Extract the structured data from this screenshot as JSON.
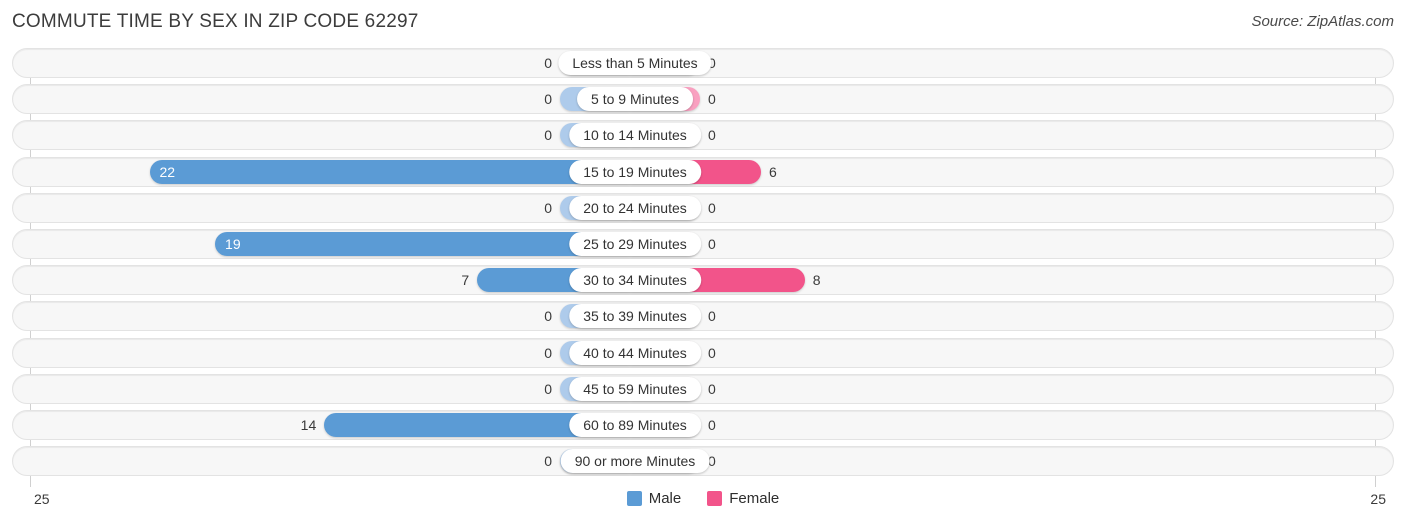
{
  "header": {
    "title": "COMMUTE TIME BY SEX IN ZIP CODE 62297",
    "source": "Source: ZipAtlas.com"
  },
  "legend": {
    "male_label": "Male",
    "female_label": "Female",
    "male_color": "#5b9bd5",
    "female_color": "#f2548a"
  },
  "axis": {
    "left_tick": "25",
    "right_tick": "25",
    "max": 25
  },
  "colors": {
    "male_active": "#5b9bd5",
    "male_muted": "#aecbeb",
    "female_active": "#f2548a",
    "female_muted": "#f9a0c0",
    "track": "#f7f7f7"
  },
  "chart_data": {
    "type": "bar",
    "orientation": "horizontal-diverging",
    "title": "COMMUTE TIME BY SEX IN ZIP CODE 62297",
    "xlabel": "",
    "ylabel": "",
    "xlim": [
      25,
      25
    ],
    "grid": false,
    "legend_position": "bottom-center",
    "categories": [
      "Less than 5 Minutes",
      "5 to 9 Minutes",
      "10 to 14 Minutes",
      "15 to 19 Minutes",
      "20 to 24 Minutes",
      "25 to 29 Minutes",
      "30 to 34 Minutes",
      "35 to 39 Minutes",
      "40 to 44 Minutes",
      "45 to 59 Minutes",
      "60 to 89 Minutes",
      "90 or more Minutes"
    ],
    "series": [
      {
        "name": "Male",
        "color": "#5b9bd5",
        "values": [
          0,
          0,
          0,
          22,
          0,
          19,
          7,
          0,
          0,
          0,
          14,
          0
        ],
        "labels": [
          "0",
          "0",
          "0",
          "22",
          "0",
          "19",
          "7",
          "0",
          "0",
          "0",
          "14",
          "0"
        ]
      },
      {
        "name": "Female",
        "color": "#f2548a",
        "values": [
          0,
          0,
          0,
          6,
          0,
          0,
          8,
          0,
          0,
          0,
          0,
          0
        ],
        "labels": [
          "0",
          "0",
          "0",
          "6",
          "0",
          "0",
          "8",
          "0",
          "0",
          "0",
          "0",
          "0"
        ]
      }
    ]
  }
}
